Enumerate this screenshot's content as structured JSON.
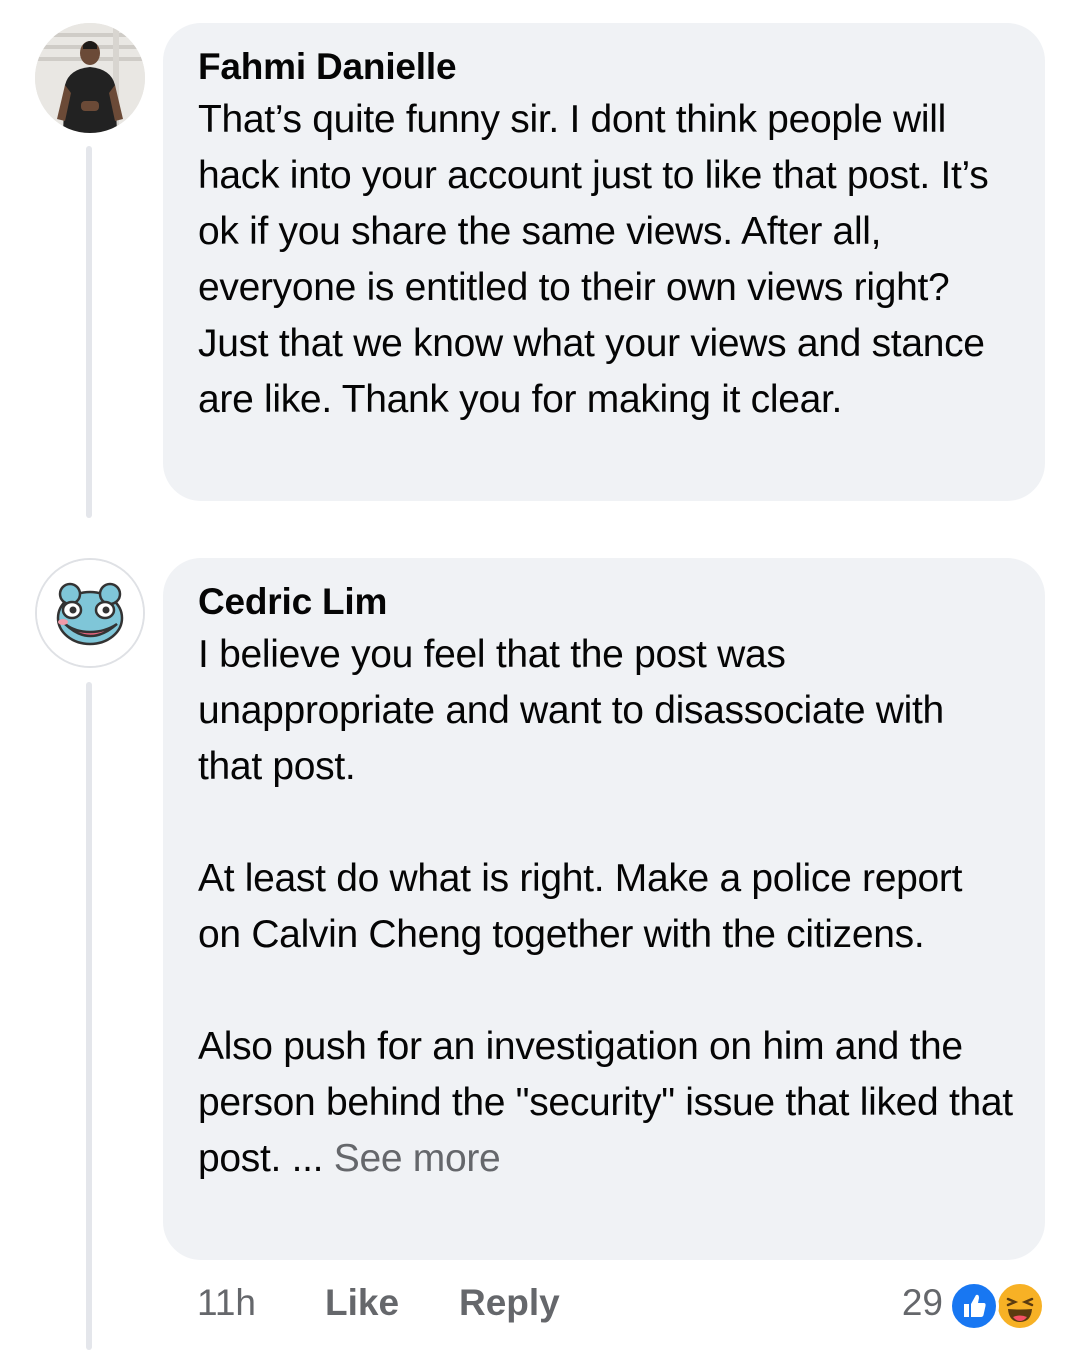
{
  "comments": [
    {
      "author": "Fahmi Danielle",
      "paragraphs": [
        "That’s quite funny sir. I dont think people will hack into your account just to like that post. It’s ok if you share the same views. After all, everyone is entitled to their own views right? Just that we know what your views and stance are like. Thank you for making it clear."
      ]
    },
    {
      "author": "Cedric Lim",
      "paragraphs": [
        "I believe you feel that the post was unappropriate and want to disassociate with that post.",
        "At least do what is right. Make a police report on Calvin Cheng together with the citizens.",
        "Also push for an investigation on him and the person behind the \"security\" issue that liked that post. ..."
      ],
      "see_more": "See more",
      "time": "11h",
      "like_label": "Like",
      "reply_label": "Reply",
      "reaction_count": "29",
      "reactions": [
        "like-icon",
        "haha-icon"
      ]
    }
  ],
  "colors": {
    "bubble": "#f0f2f5",
    "meta_text": "#65676b",
    "like_blue": "#1877f2",
    "haha_yellow": "#f7b125"
  }
}
